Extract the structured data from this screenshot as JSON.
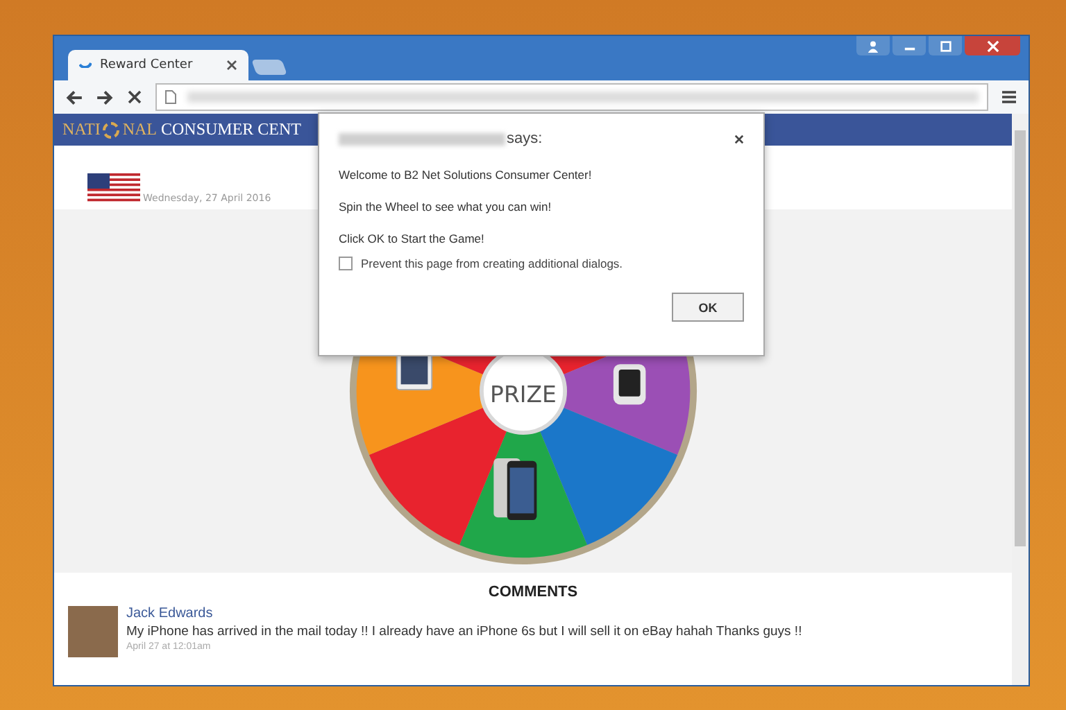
{
  "browser": {
    "tabs": [
      {
        "title": "Reward Center",
        "selected": true
      }
    ]
  },
  "site": {
    "logo_left": "NATI",
    "logo_right": "NAL",
    "title": "CONSUMER CENT",
    "date": "Wednesday, 27 April 2016"
  },
  "wheel": {
    "center_label": "PRIZE"
  },
  "dialog": {
    "origin_suffix": "says:",
    "messages": [
      "Welcome to B2 Net Solutions Consumer Center!",
      "Spin the Wheel to see what you can win!",
      "Click OK to Start the Game!"
    ],
    "checkbox": {
      "label": "Prevent this page from creating additional dialogs.",
      "checked": false
    },
    "button": "OK"
  },
  "comments": {
    "heading": "COMMENTS",
    "items": [
      {
        "author": "Jack Edwards",
        "text": "My iPhone has arrived in the mail today !! I already have an iPhone 6s but I will sell it on eBay hahah Thanks guys !!",
        "time": "April 27 at 12:01am"
      }
    ]
  }
}
